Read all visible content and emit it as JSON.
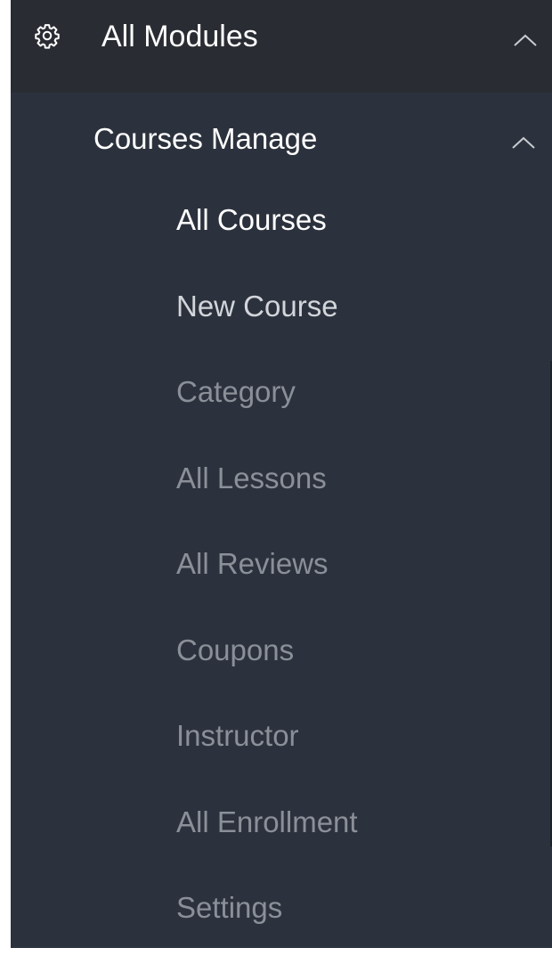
{
  "module": {
    "title": "All Modules",
    "icon": "gear-icon",
    "toggle_icon": "chevron-up-icon"
  },
  "group": {
    "title": "Courses Manage",
    "toggle_icon": "chevron-up-icon"
  },
  "items": [
    {
      "label": "All Courses",
      "state": "active"
    },
    {
      "label": "New Course",
      "state": "hover"
    },
    {
      "label": "Category",
      "state": "default"
    },
    {
      "label": "All Lessons",
      "state": "default"
    },
    {
      "label": "All Reviews",
      "state": "default"
    },
    {
      "label": "Coupons",
      "state": "default"
    },
    {
      "label": "Instructor",
      "state": "default"
    },
    {
      "label": "All Enrollment",
      "state": "default"
    },
    {
      "label": "Settings",
      "state": "default"
    }
  ],
  "colors": {
    "sidebar_bg": "#2c323d",
    "header_bg": "#292d33",
    "active_text": "#ffffff",
    "hover_text": "#d2d5da",
    "muted_text": "#8a8f98"
  }
}
